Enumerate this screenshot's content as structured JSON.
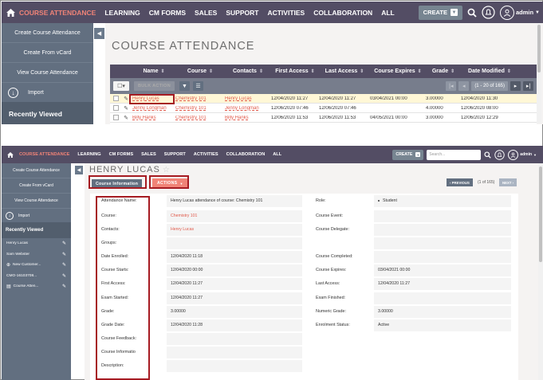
{
  "nav": {
    "module": "COURSE ATTENDANCE",
    "items": [
      "LEARNING",
      "CM FORMS",
      "SALES",
      "SUPPORT",
      "ACTIVITIES",
      "COLLABORATION",
      "ALL"
    ],
    "create_label": "CREATE",
    "search_placeholder": "Search...",
    "user": "admin"
  },
  "sidebar": {
    "actions": [
      "Create Course Attendance",
      "Create From vCard",
      "View Course Attendance"
    ],
    "import_label": "Import",
    "recent_header": "Recently Viewed",
    "recent_items": [
      "Henry Lucas",
      "Sam Webster",
      "New Customer...",
      "CMO-16103708...",
      "Course Atten..."
    ]
  },
  "list_view": {
    "title": "COURSE ATTENDANCE",
    "columns": [
      "Name",
      "Course",
      "Contacts",
      "First Access",
      "Last Access",
      "Course Expires",
      "Grade",
      "Date Modified"
    ],
    "bulk_action": "BULK ACTION",
    "pagination": "(1 - 20 of 165)",
    "rows": [
      [
        "Henry Lucas",
        "Chemistry 101",
        "Henry Lucas",
        "12/04/2020 11:27",
        "12/04/2020 11:27",
        "03/04/2021 00:00",
        "3.00000",
        "12/04/2020 11:30"
      ],
      [
        "Jenny Longman",
        "Chemistry 101",
        "Jenny Longman",
        "12/06/2020 07:46",
        "12/06/2020 07:46",
        "",
        "4.00000",
        "12/06/2020 08:00"
      ],
      [
        "Billy Hanks",
        "Chemistry 101",
        "Billy Hanks",
        "12/06/2020 11:53",
        "12/06/2020 11:53",
        "04/05/2021 00:00",
        "3.00000",
        "12/06/2020 12:29"
      ]
    ]
  },
  "detail_view": {
    "title": "HENRY LUCAS",
    "tab": "Course Information",
    "actions_label": "ACTIONS",
    "prev_label": "PREVIOUS",
    "next_label": "NEXT",
    "record_counter": "(1 of 165)",
    "left_fields": [
      {
        "label": "Attendance Name:",
        "value": "Henry Lucas attendance of course: Chemistry 101",
        "link": false
      },
      {
        "label": "Course:",
        "value": "Chemistry 101",
        "link": true
      },
      {
        "label": "Contacts:",
        "value": "Henry Lucas",
        "link": true
      },
      {
        "label": "Groups:",
        "value": "",
        "link": false
      },
      {
        "label": "Date Enrolled:",
        "value": "12/04/2020 11:18",
        "link": false
      },
      {
        "label": "Course Starts:",
        "value": "12/04/2020 00:00",
        "link": false
      },
      {
        "label": "First Access:",
        "value": "12/04/2020 11:27",
        "link": false
      },
      {
        "label": "Exam Started:",
        "value": "12/04/2020 11:27",
        "link": false
      },
      {
        "label": "Grade:",
        "value": "3.00000",
        "link": false
      },
      {
        "label": "Grade Date:",
        "value": "12/04/2020 11:28",
        "link": false
      },
      {
        "label": "Course Feedback:",
        "value": "",
        "link": false
      },
      {
        "label": "Course Informatio",
        "value": "",
        "link": false
      },
      {
        "label": "Description:",
        "value": "",
        "link": false
      }
    ],
    "right_fields": [
      {
        "label": "Role:",
        "value": "Student",
        "bullet": true
      },
      {
        "label": "Course Event:",
        "value": ""
      },
      {
        "label": "Course Delegate:",
        "value": ""
      },
      {
        "label": "",
        "value": ""
      },
      {
        "label": "Course Completed:",
        "value": ""
      },
      {
        "label": "Course Expires:",
        "value": "03/04/2021 00:00"
      },
      {
        "label": "Last Access:",
        "value": "12/04/2020 11:27"
      },
      {
        "label": "Exam Finished:",
        "value": ""
      },
      {
        "label": "Numeric Grade:",
        "value": "3.00000"
      },
      {
        "label": "Enrolment Status:",
        "value": "Active"
      }
    ]
  },
  "colors": {
    "nav_bg": "#534d64",
    "sidebar_bg": "#626f80",
    "accent": "#f08377",
    "link": "#e15a4b",
    "highlight_box": "#a61b22"
  },
  "icons": [
    "home-icon",
    "search-icon",
    "bell-icon",
    "user-avatar-icon",
    "import-icon",
    "pencil-icon",
    "filter-icon",
    "list-icon",
    "star-icon"
  ]
}
